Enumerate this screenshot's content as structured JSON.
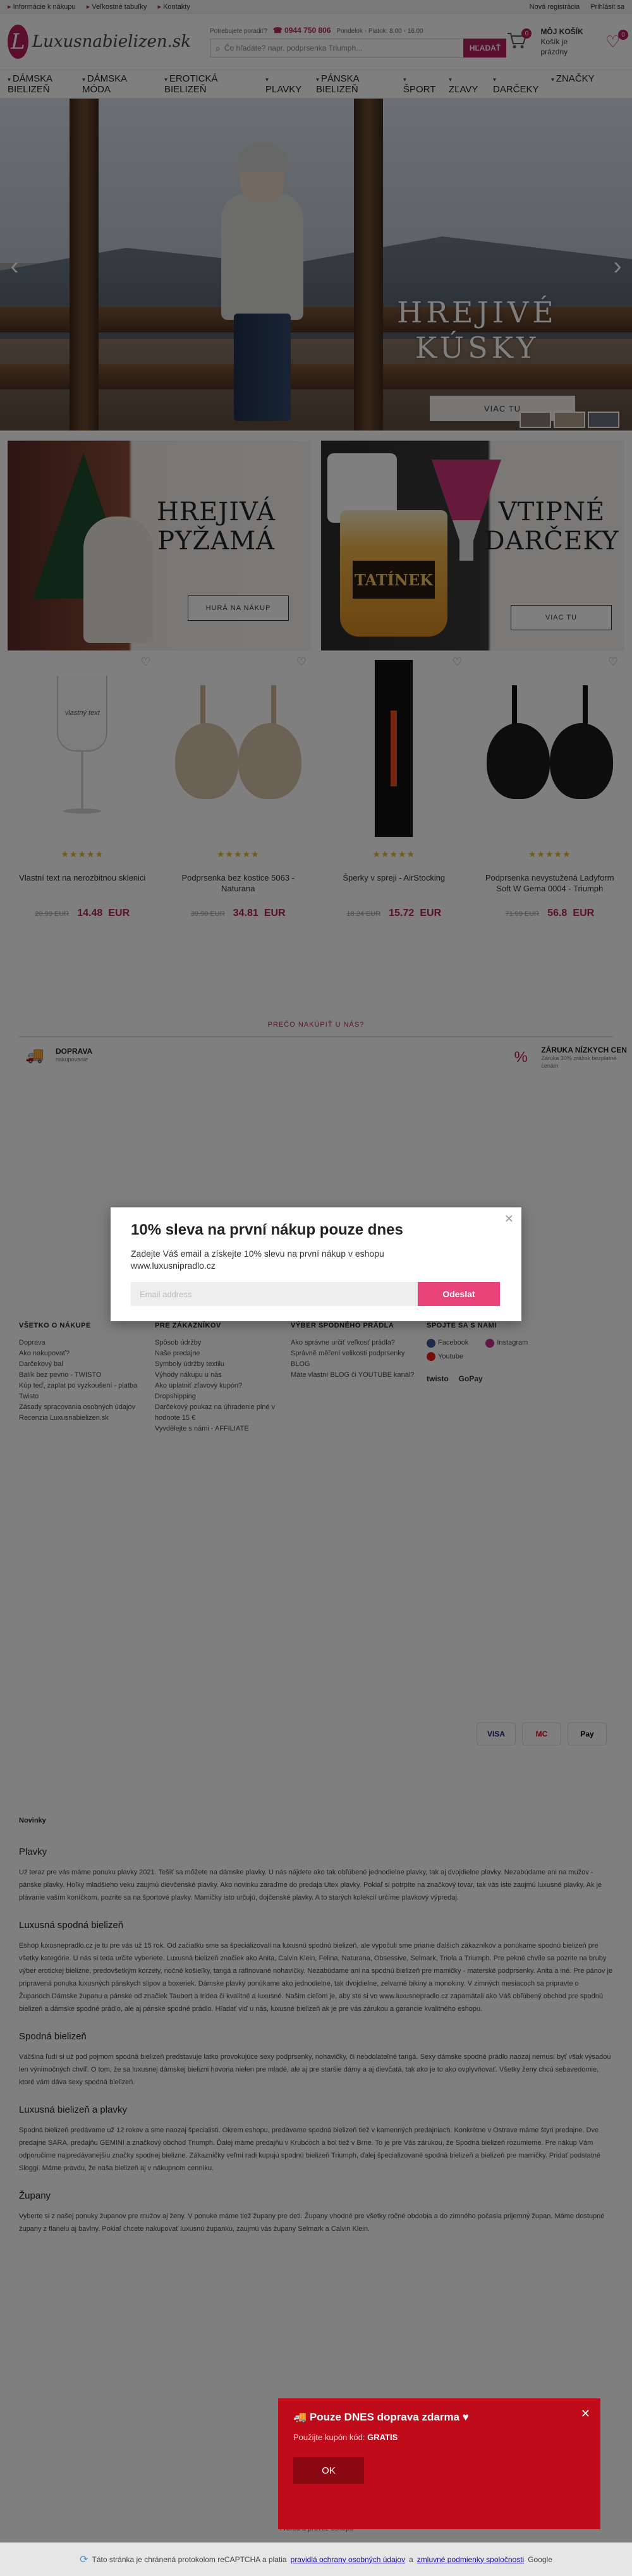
{
  "topbar": {
    "links": [
      "Informácie k nákupu",
      "Veľkostné tabuľky",
      "Kontakty"
    ],
    "register": "Nová registrácia",
    "login": "Prihlásit sa"
  },
  "header": {
    "logo_text": "Luxusnabielizen.sk",
    "help_label": "Potrebujete poradiť?",
    "phone": "0944 750 806",
    "hours": "Pondelok - Piatok: 8.00 - 16.00",
    "search_placeholder": "Čo hľadáte? napr. podprsenka Triumph...",
    "search_button": "HĽADAŤ",
    "cart_count": "0",
    "cart_title": "MÔJ KOŠÍK",
    "cart_status": "Košík je prázdny",
    "wishlist_count": "0"
  },
  "nav": [
    "DÁMSKA BIELIZEŇ",
    "DÁMSKA MÓDA",
    "EROTICKÁ BIELIZEŇ",
    "PLAVKY",
    "PÁNSKA BIELIZEŇ",
    "ŠPORT",
    "ZĽAVY",
    "DARČEKY",
    "ZNAČKY"
  ],
  "hero": {
    "title_line1": "HREJIVÉ",
    "title_line2": "KÚSKY",
    "button": "VIAC TU"
  },
  "banners": [
    {
      "title_line1": "HREJIVÁ",
      "title_line2": "PYŽAMÁ",
      "button": "HURÁ NA NÁKUP"
    },
    {
      "title_line1": "VTIPNÉ",
      "title_line2": "DARČEKY",
      "button": "VIAC TU",
      "mug_label": "TATÍNEK"
    }
  ],
  "products": [
    {
      "name": "Vlastní text na nerozbitnou sklenici",
      "old_price": "20.99 EUR",
      "new_price": "14.48",
      "currency": "EUR",
      "rating": 5,
      "glass_text": "vlastný text"
    },
    {
      "name": "Podprsenka bez kostice 5063 - Naturana",
      "old_price": "39.90 EUR",
      "new_price": "34.81",
      "currency": "EUR",
      "rating": 5
    },
    {
      "name": "Šperky v spreji - AirStocking",
      "old_price": "18.24 EUR",
      "new_price": "15.72",
      "currency": "EUR",
      "rating": 5
    },
    {
      "name": "Podprsenka nevystužená Ladyform Soft W Gema 0004 - Triumph",
      "old_price": "71.99 EUR",
      "new_price": "56.8",
      "currency": "EUR",
      "rating": 5
    }
  ],
  "usp": {
    "title": "PREČO NAKÚPIŤ U NÁS?",
    "items": [
      {
        "title": "DOPRAVA",
        "sub": "nakupovanie"
      },
      {
        "title": "ZÁRUKA NÍZKYCH CEN",
        "sub": "Záruka 30% zrážok bezplatné cenám"
      }
    ]
  },
  "footer": {
    "cols": [
      {
        "title": "VŠETKO O NÁKUPE",
        "items": [
          "Doprava",
          "Ako nakupovať?",
          "Darčekový bal",
          "Balík bez pevno - TWISTO",
          "Kúp teď, zaplat po vyzkoušení - platba Twisto",
          "Zásady spracovania osobných údajov",
          "Recenzia Luxusnabielizen.sk"
        ]
      },
      {
        "title": "PRE ZÁKAZNÍKOV",
        "items": [
          "Spôsob údržby",
          "Naše predajne",
          "Symboly údržby textilu",
          "Výhody nákupu u nás",
          "Ako uplatniť zľavový kupón?",
          "Dropshipping",
          "Darčekový poukaz na úhradenie plné v hodnote 15 €",
          "Vyvdělejte s námi - AFFILIATE"
        ]
      },
      {
        "title": "VÝBER SPODNÉHO PRÁDLA",
        "items": [
          "Ako správne určiť veľkosť prádla?",
          "Správně měření velikosti podprsenky",
          "BLOG",
          "Máte vlastní BLOG či YOUTUBE kanál?"
        ]
      },
      {
        "title": "SPOJTE SA S NAMI",
        "social": [
          "Facebook",
          "Instagram",
          "Youtube"
        ],
        "badges": [
          "twisto",
          "GoPay"
        ]
      }
    ],
    "payments": [
      "VISA",
      "MC",
      "Pay"
    ]
  },
  "seo": {
    "label": "Novinky",
    "sections": [
      {
        "h": "Plavky",
        "p": "Už teraz pre vás máme ponuku plavky 2021. Tešíť sa môžete na dámske plavky. U nás nájdete ako tak obľúbené jednodielne plavky, tak aj dvojdielne plavky. Nezabúdame ani na mužov - pánske plavky. Hoľky mladšieho veku zaujmú dievčenské plavky. Ako novinku zaraďme do predaja Utex plavky. Pokiaľ si potrpíte na značkový tovar, tak vás iste zaujmú luxusné plavky. Ak je plávanie vaším koníčkom, pozrite sa na športové plavky. Mamičky isto určujú, dojčenské plavky. A to starých kolekcií určíme plavkový výpredaj."
      },
      {
        "h": "Luxusná spodná bielizeň",
        "p": "Eshop luxusnepradlo.cz je tu pre vás už 15 rok. Od začiatku sme sa špecializovali na luxusnú spodnú bielizeň, ale vypočuli sme prianie ďalších zákazníkov a ponúkame spodnú bielizeň pre všetky kategórie. U nás si teda určite vyberiete. Luxusná bielizeň značiek ako Anita, Calvin Klein, Felina, Naturana, Obsessive, Selmark, Triola a Triumph. Pre pekné chvíle sa pozrite na bruby výber erotickej bielizne, predovšetkým korzety, nočné košieľky, tangá a rafinované nohavičky. Nezabúdame ani na spodnú bielizeň pre mamičky - materské podprsenky. Anita a iné. Pre pánov je pripravená ponuka luxusných pánskych slipov a boxeriek. Dámske plavky ponúkame ako jednodielne, tak dvojdielne, zelvarné bikiny a monokiny. V zimných mesiacoch sa pripravte o Županoch.Dámske županu a pánske od značiek Taubert a Iridea či kvalitné a luxusné. Našim cieľom je, aby ste si vo www.luxusnepradlo.cz zapamätali ako Váš obľúbený obchod pre spodnú bielizeň a dámske spodné prádlo, ale aj pánske spodné prádlo. Hľadať viď u nás, luxusné bielizeň ak je pre vás zárukou a garancie kvalitného eshopu."
      },
      {
        "h": "Spodná bielizeň",
        "p": "Väčšina ľudí si už pod pojmom spodná bielizeň predstavuje latko provokujúce sexy podprsenky, nohavičky, či neodolateľné tangá. Sexy dámske spodné prádlo naozaj nemusí byť však výsadou len výnimočných chvíľ. O tom, že sa luxusnej dámskej bielizni hovoria nielen pre mladé, ale aj pre staršie dámy a aj dievčatá, tak ako je to ako ovplyvňovať. Všetky ženy chcú sebavedomie, ktoré vám dáva sexy spodná bielizeň."
      },
      {
        "h": "Luxusná bielizeň a plavky",
        "p": "Spodná bielizeň predávame už 12 rokov a sme naozaj špecialisti. Okrem eshopu, predávame spodná bielizeň tiež v kamenných predajniach. Konkrétne v Ostrave máme štyri predajne. Dve predajne SARA, predajňu GEMINI a značkový obchod Triumph. Ďalej máme predajňu v Krubcoch a bol tiež v Brne. To je pre Vás zárukou, že Spodná bielizeň rozumieme. Pre nákup Vám odporučíme najpredávanejšiu značky spodnej bielizne. Zákazníčky veľmi radi kupujú spodnú bielizeň Triumph, ďalej špecializované spodná bielizeň a bielizeň pre mamičky. Pridať podstatné Sloggi. Máme pravdu, že naša bielizeň aj v nákupnom cenníku."
      },
      {
        "h": "Župany",
        "p": "Vyberte si z našej ponuky županov pre mužov aj ženy. V ponuke máme tiež župany pre deti. Župany vhodné pre všetky ročné obdobia a do zimného počasia prijemný župan. Máme dostupné župany z flanelu aj bavlny. Pokiaľ chcete nakupovať luxusnú županku, zaujmú vás župany Selmark a Calvin Klein."
      }
    ]
  },
  "modal": {
    "title": "10% sleva na první nákup pouze dnes",
    "text": "Zadejte Váš email a získejte 10% slevu na první nákup v eshopu www.luxusnipradlo.cz",
    "email_placeholder": "Email address",
    "button": "Odeslat"
  },
  "toast": {
    "title": "Pouze DNES doprava zdarma",
    "sub_prefix": "Použijte kupón kód:",
    "code": "GRATIS",
    "button": "OK"
  },
  "credits": "Tvorba a provoz eshopu",
  "captcha": {
    "text": "Táto stránka je chránená protokolom reCAPTCHA a platia",
    "link1": "pravidlá ochrany osobných údajov",
    "and": "a",
    "link2": "zmluvné podmienky spoločnosti",
    "brand": "Google"
  }
}
